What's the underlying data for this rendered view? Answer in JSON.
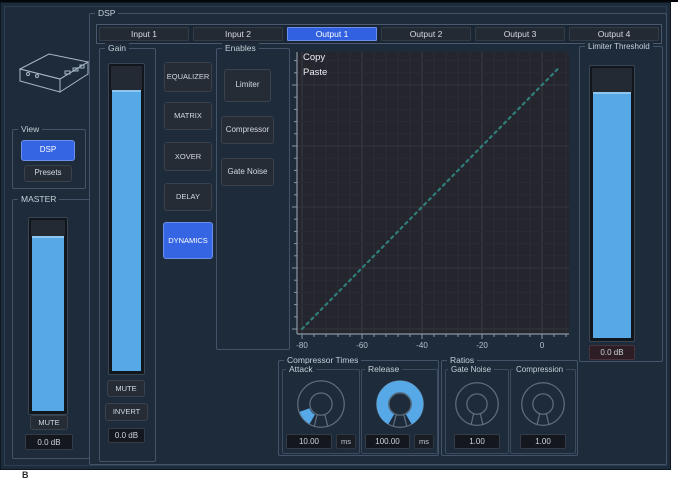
{
  "colors": {
    "accent_blue": "#3565e2",
    "fader_blue": "#56a8e6",
    "curve_teal": "#2f7e78",
    "window_bg": "#1d2b3b"
  },
  "dsp_group_label": "DSP",
  "tabs": [
    {
      "label": "Input 1",
      "active": false
    },
    {
      "label": "Input 2",
      "active": false
    },
    {
      "label": "Output 1",
      "active": true
    },
    {
      "label": "Output 2",
      "active": false
    },
    {
      "label": "Output 3",
      "active": false
    },
    {
      "label": "Output 4",
      "active": false
    }
  ],
  "view": {
    "label": "View",
    "buttons": [
      {
        "label": "DSP",
        "active": true
      },
      {
        "label": "Presets",
        "active": false
      }
    ]
  },
  "master": {
    "label": "MASTER",
    "mute_label": "MUTE",
    "value": "0.0 dB"
  },
  "gain": {
    "label": "Gain",
    "mute_label": "MUTE",
    "invert_label": "INVERT",
    "value": "0.0 dB"
  },
  "dsp_sections": [
    {
      "label": "EQUALIZER",
      "active": false
    },
    {
      "label": "MATRIX",
      "active": false
    },
    {
      "label": "XOVER",
      "active": false
    },
    {
      "label": "DELAY",
      "active": false
    },
    {
      "label": "DYNAMICS",
      "active": true
    }
  ],
  "enables": {
    "label": "Enables",
    "buttons": [
      {
        "label": "Limiter"
      },
      {
        "label": "Compressor"
      },
      {
        "label": "Gate Noise"
      }
    ]
  },
  "graph": {
    "context_menu": [
      {
        "label": "Copy"
      },
      {
        "label": "Paste"
      }
    ],
    "chart_data": {
      "type": "line",
      "title": "",
      "xlabel": "",
      "ylabel": "",
      "xlim": [
        -82,
        9
      ],
      "ylim": [
        -82,
        11
      ],
      "x_ticks": [
        -80,
        -60,
        -40,
        -20,
        0
      ],
      "y_ticks": [
        0,
        -20,
        -40,
        -60,
        -80
      ],
      "minor_tick_step_db": 4,
      "grid": true,
      "series": [
        {
          "name": "limiter-transfer-curve",
          "style": "dotted",
          "points": [
            [
              -80,
              -80
            ],
            [
              6,
              6
            ]
          ]
        }
      ]
    }
  },
  "limiter_threshold": {
    "label": "Limiter Threshold",
    "value": "0.0 dB"
  },
  "compressor_times": {
    "label": "Compressor Times",
    "attack": {
      "label": "Attack",
      "value": "10.00",
      "unit": "ms"
    },
    "release": {
      "label": "Release",
      "value": "100.00",
      "unit": "ms"
    }
  },
  "ratios": {
    "label": "Ratios",
    "gate_noise": {
      "label": "Gate Noise",
      "value": "1.00"
    },
    "compression": {
      "label": "Compression",
      "value": "1.00"
    }
  },
  "footer_mark": "B"
}
